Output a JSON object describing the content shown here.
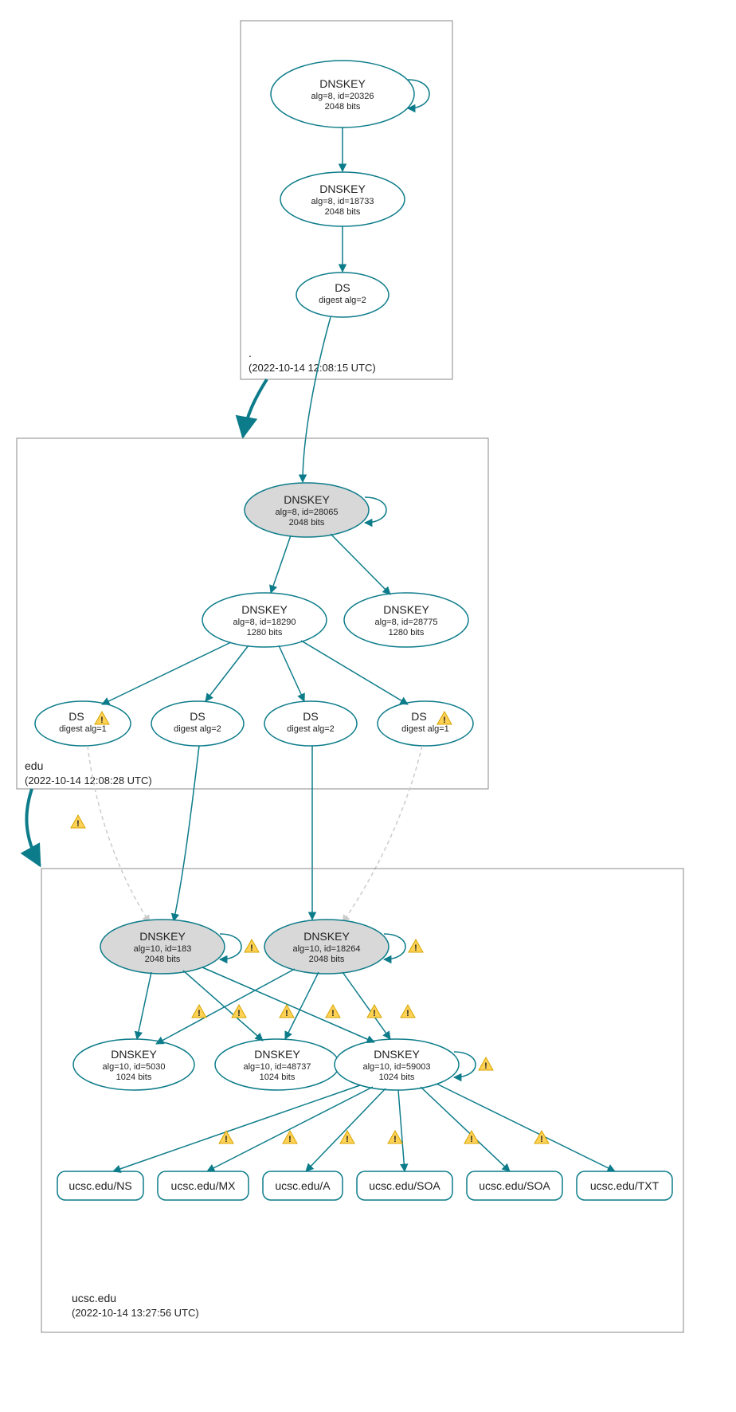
{
  "chart_data": {
    "type": "diagram",
    "title": "DNSSEC Authentication Chain for ucsc.edu",
    "zones": [
      {
        "name": ".",
        "timestamp": "2022-10-14 12:08:15 UTC"
      },
      {
        "name": "edu",
        "timestamp": "2022-10-14 12:08:28 UTC"
      },
      {
        "name": "ucsc.edu",
        "timestamp": "2022-10-14 13:27:56 UTC"
      }
    ],
    "nodes": [
      {
        "id": "root-ksk",
        "zone": ".",
        "type": "DNSKEY",
        "alg": 8,
        "keyid": 20326,
        "bits": 2048,
        "ksk": true,
        "trust_anchor": true
      },
      {
        "id": "root-zsk",
        "zone": ".",
        "type": "DNSKEY",
        "alg": 8,
        "keyid": 18733,
        "bits": 2048
      },
      {
        "id": "root-ds",
        "zone": ".",
        "type": "DS",
        "digest_alg": 2
      },
      {
        "id": "edu-ksk",
        "zone": "edu",
        "type": "DNSKEY",
        "alg": 8,
        "keyid": 28065,
        "bits": 2048,
        "ksk": true
      },
      {
        "id": "edu-zsk1",
        "zone": "edu",
        "type": "DNSKEY",
        "alg": 8,
        "keyid": 18290,
        "bits": 1280
      },
      {
        "id": "edu-zsk2",
        "zone": "edu",
        "type": "DNSKEY",
        "alg": 8,
        "keyid": 28775,
        "bits": 1280
      },
      {
        "id": "edu-ds1",
        "zone": "edu",
        "type": "DS",
        "digest_alg": 1,
        "warning": true
      },
      {
        "id": "edu-ds2",
        "zone": "edu",
        "type": "DS",
        "digest_alg": 2
      },
      {
        "id": "edu-ds3",
        "zone": "edu",
        "type": "DS",
        "digest_alg": 2
      },
      {
        "id": "edu-ds4",
        "zone": "edu",
        "type": "DS",
        "digest_alg": 1,
        "warning": true
      },
      {
        "id": "ucsc-ksk1",
        "zone": "ucsc.edu",
        "type": "DNSKEY",
        "alg": 10,
        "keyid": 183,
        "bits": 2048,
        "ksk": true,
        "warning": true
      },
      {
        "id": "ucsc-ksk2",
        "zone": "ucsc.edu",
        "type": "DNSKEY",
        "alg": 10,
        "keyid": 18264,
        "bits": 2048,
        "ksk": true,
        "warning": true
      },
      {
        "id": "ucsc-zsk1",
        "zone": "ucsc.edu",
        "type": "DNSKEY",
        "alg": 10,
        "keyid": 5030,
        "bits": 1024
      },
      {
        "id": "ucsc-zsk2",
        "zone": "ucsc.edu",
        "type": "DNSKEY",
        "alg": 10,
        "keyid": 48737,
        "bits": 1024
      },
      {
        "id": "ucsc-zsk3",
        "zone": "ucsc.edu",
        "type": "DNSKEY",
        "alg": 10,
        "keyid": 59003,
        "bits": 1024,
        "warning": true
      },
      {
        "id": "rr-ns",
        "zone": "ucsc.edu",
        "type": "RRset",
        "label": "ucsc.edu/NS"
      },
      {
        "id": "rr-mx",
        "zone": "ucsc.edu",
        "type": "RRset",
        "label": "ucsc.edu/MX"
      },
      {
        "id": "rr-a",
        "zone": "ucsc.edu",
        "type": "RRset",
        "label": "ucsc.edu/A"
      },
      {
        "id": "rr-soa1",
        "zone": "ucsc.edu",
        "type": "RRset",
        "label": "ucsc.edu/SOA"
      },
      {
        "id": "rr-soa2",
        "zone": "ucsc.edu",
        "type": "RRset",
        "label": "ucsc.edu/SOA"
      },
      {
        "id": "rr-txt",
        "zone": "ucsc.edu",
        "type": "RRset",
        "label": "ucsc.edu/TXT"
      }
    ],
    "edges": [
      {
        "from": "root-ksk",
        "to": "root-ksk",
        "self": true
      },
      {
        "from": "root-ksk",
        "to": "root-zsk"
      },
      {
        "from": "root-zsk",
        "to": "root-ds"
      },
      {
        "from": ".",
        "to": "edu",
        "delegation": true
      },
      {
        "from": "root-ds",
        "to": "edu-ksk"
      },
      {
        "from": "edu-ksk",
        "to": "edu-ksk",
        "self": true
      },
      {
        "from": "edu-ksk",
        "to": "edu-zsk1"
      },
      {
        "from": "edu-ksk",
        "to": "edu-zsk2"
      },
      {
        "from": "edu-zsk1",
        "to": "edu-ds1"
      },
      {
        "from": "edu-zsk1",
        "to": "edu-ds2"
      },
      {
        "from": "edu-zsk1",
        "to": "edu-ds3"
      },
      {
        "from": "edu-zsk1",
        "to": "edu-ds4"
      },
      {
        "from": "edu",
        "to": "ucsc.edu",
        "delegation": true,
        "warning": true
      },
      {
        "from": "edu-ds1",
        "to": "ucsc-ksk1",
        "dashed": true
      },
      {
        "from": "edu-ds2",
        "to": "ucsc-ksk1"
      },
      {
        "from": "edu-ds3",
        "to": "ucsc-ksk2"
      },
      {
        "from": "edu-ds4",
        "to": "ucsc-ksk2",
        "dashed": true
      },
      {
        "from": "ucsc-ksk1",
        "to": "ucsc-ksk1",
        "self": true
      },
      {
        "from": "ucsc-ksk2",
        "to": "ucsc-ksk2",
        "self": true
      },
      {
        "from": "ucsc-ksk1",
        "to": "ucsc-zsk1",
        "warning": true
      },
      {
        "from": "ucsc-ksk1",
        "to": "ucsc-zsk2",
        "warning": true
      },
      {
        "from": "ucsc-ksk1",
        "to": "ucsc-zsk3",
        "warning": true
      },
      {
        "from": "ucsc-ksk2",
        "to": "ucsc-zsk1",
        "warning": true
      },
      {
        "from": "ucsc-ksk2",
        "to": "ucsc-zsk2",
        "warning": true
      },
      {
        "from": "ucsc-ksk2",
        "to": "ucsc-zsk3",
        "warning": true
      },
      {
        "from": "ucsc-zsk3",
        "to": "ucsc-zsk3",
        "self": true
      },
      {
        "from": "ucsc-zsk3",
        "to": "rr-ns",
        "warning": true
      },
      {
        "from": "ucsc-zsk3",
        "to": "rr-mx",
        "warning": true
      },
      {
        "from": "ucsc-zsk3",
        "to": "rr-a",
        "warning": true
      },
      {
        "from": "ucsc-zsk3",
        "to": "rr-soa1",
        "warning": true
      },
      {
        "from": "ucsc-zsk3",
        "to": "rr-soa2",
        "warning": true
      },
      {
        "from": "ucsc-zsk3",
        "to": "rr-txt",
        "warning": true
      }
    ]
  },
  "labels": {
    "dnskey": "DNSKEY",
    "ds": "DS",
    "digest_prefix": "digest alg=",
    "alg_prefix": "alg=",
    "id_prefix": ", id=",
    "bits_suffix": " bits"
  },
  "zones": {
    "root": {
      "name": ".",
      "time": "(2022-10-14 12:08:15 UTC)"
    },
    "edu": {
      "name": "edu",
      "time": "(2022-10-14 12:08:28 UTC)"
    },
    "ucsc": {
      "name": "ucsc.edu",
      "time": "(2022-10-14 13:27:56 UTC)"
    }
  },
  "nodes": {
    "root_ksk": {
      "t": "DNSKEY",
      "l2": "alg=8, id=20326",
      "l3": "2048 bits"
    },
    "root_zsk": {
      "t": "DNSKEY",
      "l2": "alg=8, id=18733",
      "l3": "2048 bits"
    },
    "root_ds": {
      "t": "DS",
      "l2": "digest alg=2"
    },
    "edu_ksk": {
      "t": "DNSKEY",
      "l2": "alg=8, id=28065",
      "l3": "2048 bits"
    },
    "edu_zsk1": {
      "t": "DNSKEY",
      "l2": "alg=8, id=18290",
      "l3": "1280 bits"
    },
    "edu_zsk2": {
      "t": "DNSKEY",
      "l2": "alg=8, id=28775",
      "l3": "1280 bits"
    },
    "edu_ds1": {
      "t": "DS",
      "l2": "digest alg=1"
    },
    "edu_ds2": {
      "t": "DS",
      "l2": "digest alg=2"
    },
    "edu_ds3": {
      "t": "DS",
      "l2": "digest alg=2"
    },
    "edu_ds4": {
      "t": "DS",
      "l2": "digest alg=1"
    },
    "ucsc_ksk1": {
      "t": "DNSKEY",
      "l2": "alg=10, id=183",
      "l3": "2048 bits"
    },
    "ucsc_ksk2": {
      "t": "DNSKEY",
      "l2": "alg=10, id=18264",
      "l3": "2048 bits"
    },
    "ucsc_zsk1": {
      "t": "DNSKEY",
      "l2": "alg=10, id=5030",
      "l3": "1024 bits"
    },
    "ucsc_zsk2": {
      "t": "DNSKEY",
      "l2": "alg=10, id=48737",
      "l3": "1024 bits"
    },
    "ucsc_zsk3": {
      "t": "DNSKEY",
      "l2": "alg=10, id=59003",
      "l3": "1024 bits"
    },
    "rr_ns": {
      "t": "ucsc.edu/NS"
    },
    "rr_mx": {
      "t": "ucsc.edu/MX"
    },
    "rr_a": {
      "t": "ucsc.edu/A"
    },
    "rr_soa1": {
      "t": "ucsc.edu/SOA"
    },
    "rr_soa2": {
      "t": "ucsc.edu/SOA"
    },
    "rr_txt": {
      "t": "ucsc.edu/TXT"
    }
  }
}
